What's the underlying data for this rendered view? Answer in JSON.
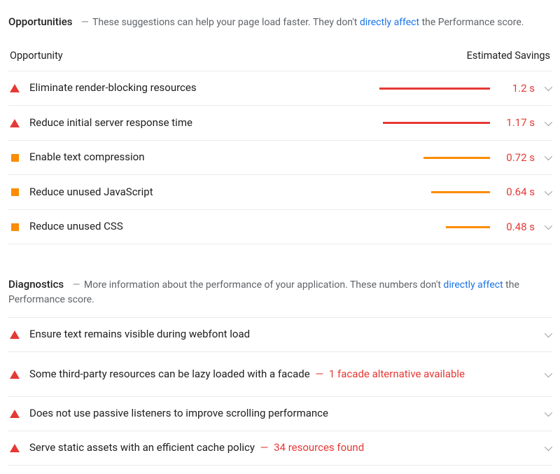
{
  "opportunities": {
    "title": "Opportunities",
    "desc_pre": "These suggestions can help your page load faster. They don't ",
    "desc_link": "directly affect",
    "desc_post": " the Performance score.",
    "col_opportunity": "Opportunity",
    "col_savings": "Estimated Savings",
    "items": [
      {
        "label": "Eliminate render-blocking resources",
        "savings": "1.2 s",
        "severity": "red",
        "bar": 100
      },
      {
        "label": "Reduce initial server response time",
        "savings": "1.17 s",
        "severity": "red",
        "bar": 97
      },
      {
        "label": "Enable text compression",
        "savings": "0.72 s",
        "severity": "orange",
        "bar": 60
      },
      {
        "label": "Reduce unused JavaScript",
        "savings": "0.64 s",
        "severity": "orange",
        "bar": 53
      },
      {
        "label": "Reduce unused CSS",
        "savings": "0.48 s",
        "severity": "orange",
        "bar": 40
      }
    ]
  },
  "diagnostics": {
    "title": "Diagnostics",
    "desc_pre": "More information about the performance of your application. These numbers don't ",
    "desc_link": "directly affect",
    "desc_post": " the Performance score.",
    "items": [
      {
        "label": "Ensure text remains visible during webfont load",
        "annotation": ""
      },
      {
        "label": "Some third-party resources can be lazy loaded with a facade",
        "annotation": "1 facade alternative available"
      },
      {
        "label": "Does not use passive listeners to improve scrolling performance",
        "annotation": ""
      },
      {
        "label": "Serve static assets with an efficient cache policy",
        "annotation": "34 resources found"
      }
    ]
  },
  "dash": "—"
}
